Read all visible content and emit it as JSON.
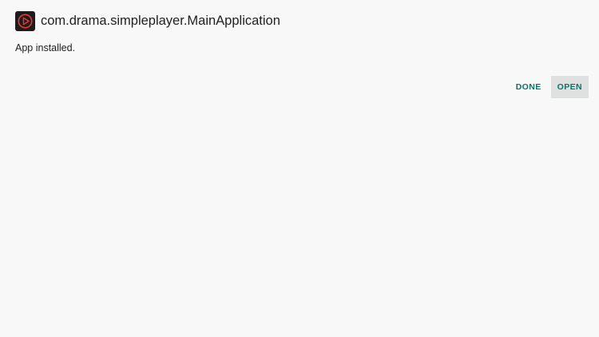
{
  "dialog": {
    "title": "com.drama.simpleplayer.MainApplication",
    "message": "App installed.",
    "icon": "play-app-icon"
  },
  "actions": {
    "done_label": "DONE",
    "open_label": "OPEN"
  },
  "colors": {
    "background": "#f8f8f8",
    "accent": "#00796b",
    "focus": "#dfe0e0",
    "icon_ring": "#e53935"
  }
}
